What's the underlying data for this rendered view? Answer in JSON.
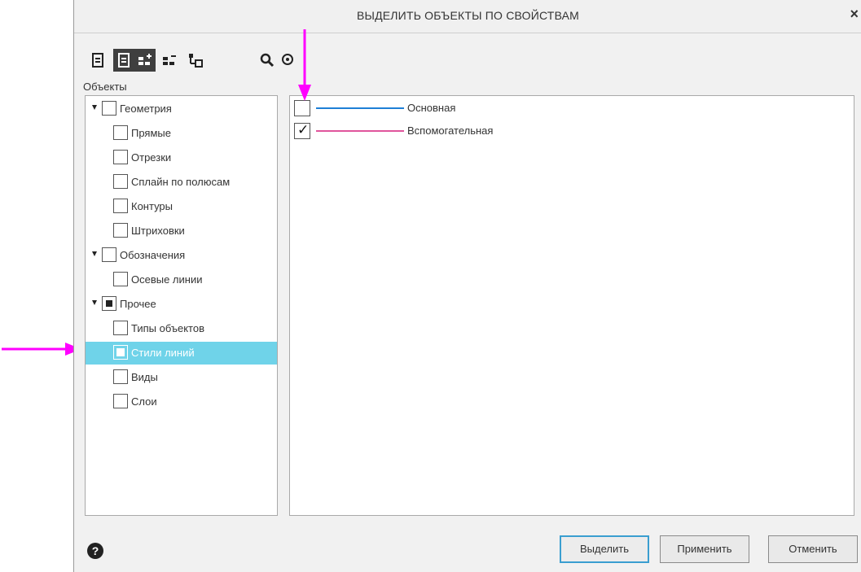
{
  "dialog": {
    "title": "ВЫДЕЛИТЬ ОБЪЕКТЫ ПО СВОЙСТВАМ",
    "close_label": "×"
  },
  "toolbar": {
    "buttons": [
      {
        "icon": "document-icon",
        "active": false
      },
      {
        "icon": "document-lines-icon",
        "active": true
      },
      {
        "icon": "tree-add-icon",
        "active": true
      },
      {
        "icon": "tree-remove-icon",
        "active": false
      },
      {
        "icon": "hierarchy-icon",
        "active": false
      },
      {
        "icon": "search-icon",
        "active": false
      },
      {
        "icon": "zoom-target-icon",
        "active": false
      }
    ]
  },
  "objects_label": "Объекты",
  "tree": [
    {
      "label": "Геометрия",
      "expander": true,
      "state": "unchecked"
    },
    {
      "label": "Прямые",
      "state": "unchecked"
    },
    {
      "label": "Отрезки",
      "state": "unchecked"
    },
    {
      "label": "Сплайн по полюсам",
      "state": "unchecked"
    },
    {
      "label": "Контуры",
      "state": "unchecked"
    },
    {
      "label": "Штриховки",
      "state": "unchecked"
    },
    {
      "label": "Обозначения",
      "expander": true,
      "state": "unchecked"
    },
    {
      "label": "Осевые линии",
      "state": "unchecked"
    },
    {
      "label": "Прочее",
      "expander": true,
      "state": "partial"
    },
    {
      "label": "Типы объектов",
      "state": "unchecked"
    },
    {
      "label": "Стили линий",
      "state": "partial",
      "selected": true
    },
    {
      "label": "Виды",
      "state": "unchecked"
    },
    {
      "label": "Слои",
      "state": "unchecked"
    }
  ],
  "line_styles": [
    {
      "label": "Основная",
      "checked": false,
      "color": "#1e7fd6"
    },
    {
      "label": "Вспомогательная",
      "checked": true,
      "color": "#e0559c"
    }
  ],
  "check_glyph": "✓",
  "help_glyph": "?",
  "buttons": {
    "select": "Выделить",
    "apply": "Применить",
    "cancel": "Отменить"
  },
  "accent_colors": {
    "selection": "#6fd3e9",
    "annotation_arrow": "#ff00ff",
    "focus_border": "#3a9ed0"
  }
}
